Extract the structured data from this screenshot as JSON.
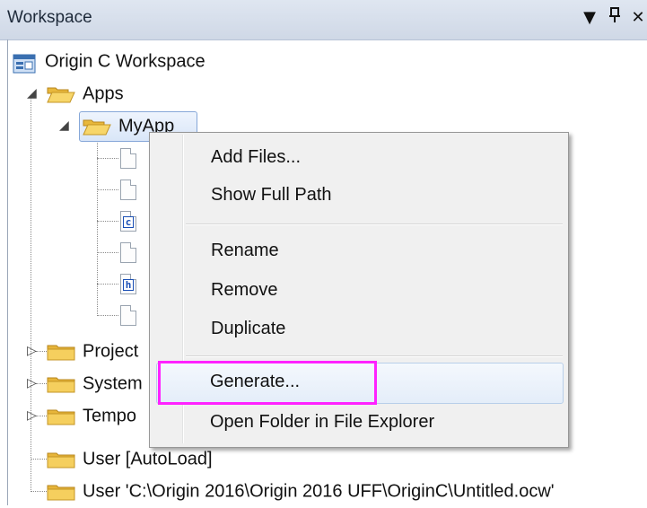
{
  "panel": {
    "title": "Workspace",
    "dropdown_glyph": "▼",
    "pin_glyph": "ᵖ",
    "close_glyph": "✕"
  },
  "tree": {
    "root_label": "Origin C Workspace",
    "apps_label": "Apps",
    "myapp_label": "MyApp",
    "file_types": [
      "",
      "",
      "c",
      "",
      "h",
      ""
    ],
    "project_label": "Project",
    "system_label": "System",
    "temp_label": "Tempo",
    "user_autoload_label": "User  [AutoLoad]",
    "user_path_label": "User 'C:\\Origin 2016\\Origin 2016 UFF\\OriginC\\Untitled.ocw'"
  },
  "context_menu": {
    "items": [
      {
        "label": "Add Files..."
      },
      {
        "label": "Show Full Path"
      },
      {
        "label": "Rename"
      },
      {
        "label": "Remove"
      },
      {
        "label": "Duplicate"
      },
      {
        "label": "Generate..."
      },
      {
        "label": "Open Folder in File Explorer"
      }
    ],
    "highlighted_item": "Generate...",
    "highlight_color": "#ff22ff"
  }
}
